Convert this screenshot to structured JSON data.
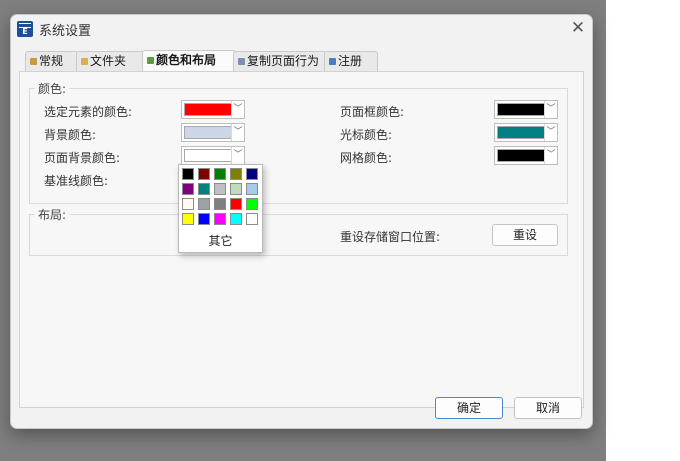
{
  "window": {
    "title": "系统设置",
    "close_glyph": "✕"
  },
  "tabs": [
    "常规",
    "文件夹",
    "颜色和布局",
    "复制页面行为",
    "注册"
  ],
  "colors_group": {
    "legend": "颜色:",
    "selected_element_label": "选定元素的颜色:",
    "selected_element_color": "#ff0000",
    "background_label": "背景颜色:",
    "background_color": "#cdd6e6",
    "page_background_label": "页面背景颜色:",
    "page_background_color": "#ffffff",
    "baseline_label": "基准线颜色:",
    "page_border_label": "页面框颜色:",
    "page_border_color": "#000000",
    "cursor_label": "光标颜色:",
    "cursor_color": "#008080",
    "grid_label": "网格颜色:",
    "grid_color": "#000000"
  },
  "layout_group": {
    "legend": "布局:",
    "reset_label": "重设存储窗口位置:",
    "reset_button": "重设"
  },
  "color_popup": {
    "palette": [
      "#000000",
      "#800000",
      "#008000",
      "#808000",
      "#000080",
      "#800080",
      "#008080",
      "#c0c0c0",
      "#c0dcc0",
      "#a6caf0",
      "#fffbf0",
      "#a0a0a4",
      "#808080",
      "#ff0000",
      "#00ff00",
      "#ffff00",
      "#0000ff",
      "#ff00ff",
      "#00ffff",
      "#ffffff"
    ],
    "other_label": "其它"
  },
  "footer": {
    "ok": "确定",
    "cancel": "取消"
  }
}
